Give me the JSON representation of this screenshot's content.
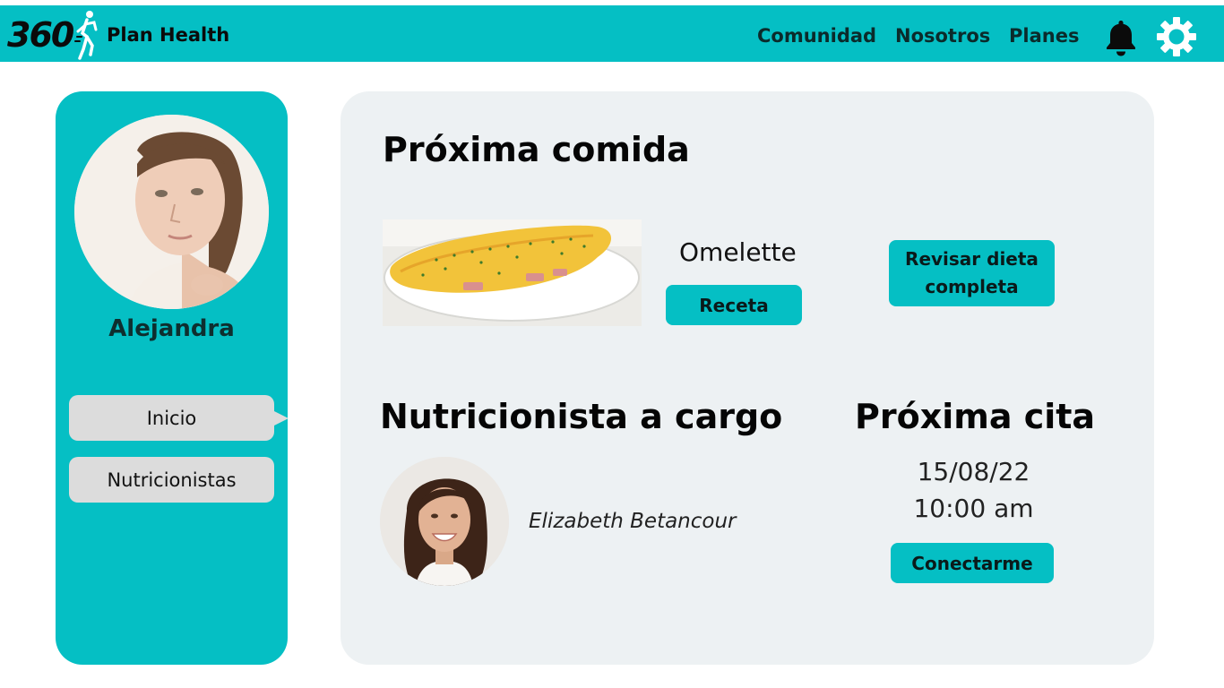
{
  "header": {
    "logo_text": "360",
    "brand": "Plan Health",
    "nav": [
      "Comunidad",
      "Nosotros",
      "Planes"
    ],
    "icons": [
      "bell-icon",
      "gear-icon"
    ]
  },
  "sidebar": {
    "user_name": "Alejandra",
    "items": [
      {
        "label": "Inicio",
        "active": true
      },
      {
        "label": "Nutricionistas",
        "active": false
      }
    ]
  },
  "main": {
    "next_meal": {
      "title": "Próxima comida",
      "meal_name": "Omelette",
      "recipe_button": "Receta",
      "diet_button": "Revisar dieta completa"
    },
    "nutritionist": {
      "title": "Nutricionista a cargo",
      "name": "Elizabeth Betancour"
    },
    "appointment": {
      "title": "Próxima cita",
      "date": "15/08/22",
      "time": "10:00 am",
      "connect_button": "Conectarme"
    }
  },
  "colors": {
    "accent": "#05bfc4",
    "card_bg": "#edf1f3",
    "sidebar_button": "#dcdcdc"
  }
}
